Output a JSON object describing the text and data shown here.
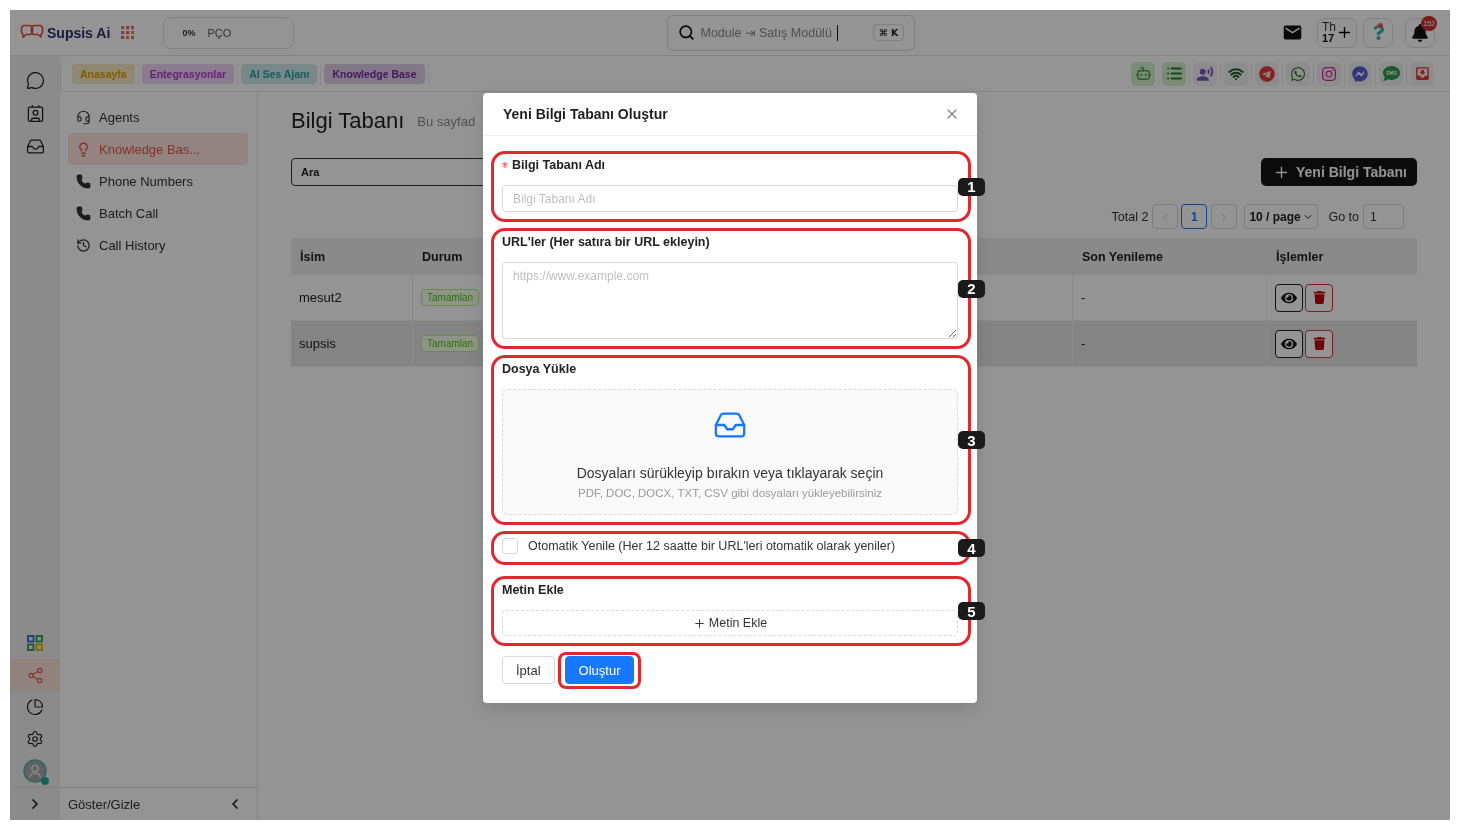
{
  "header": {
    "brand": "Supsis Ai",
    "usage": {
      "percent": "0%",
      "label": "PÇO"
    },
    "search": {
      "value": "Module ⇥ Satış Modülü",
      "shortcut": "⌘ K"
    },
    "calendar": {
      "weekday": "Th",
      "day": "17"
    },
    "help": {
      "alert": true
    },
    "notifications": {
      "count": "152"
    }
  },
  "tabs": [
    {
      "label": "Anasayfa",
      "color": "#908873"
    },
    {
      "label": "Entegrasyonlar",
      "color": "#8a7b8e"
    },
    {
      "label": "AI Ses Ajanı",
      "color": "#788888"
    },
    {
      "label": "Knowledge Base",
      "color": "#837888"
    }
  ],
  "channels": [
    {
      "active": true
    },
    {
      "active": true
    },
    {
      "active": false
    },
    {
      "active": false
    },
    {
      "active": false
    },
    {
      "active": false
    },
    {
      "active": false
    },
    {
      "active": false
    },
    {
      "active": false
    },
    {
      "active": false
    }
  ],
  "rail": {
    "top": [
      {
        "selected": false
      },
      {
        "selected": false
      },
      {
        "selected": false
      }
    ],
    "bottom": [
      {
        "selected": false
      },
      {
        "selected": true
      },
      {
        "selected": false
      },
      {
        "selected": false
      }
    ],
    "user": {
      "online": true
    }
  },
  "sidebar": {
    "items": [
      {
        "label": "Agents",
        "selected": false
      },
      {
        "label": "Knowledge Bas...",
        "selected": true
      },
      {
        "label": "Phone Numbers",
        "selected": false
      },
      {
        "label": "Batch Call",
        "selected": false
      },
      {
        "label": "Call History",
        "selected": false
      }
    ],
    "footer": "Göster/Gizle"
  },
  "page": {
    "title": "Bilgi Tabanı",
    "subtitle": "Bu sayfad",
    "search": {
      "placeholder": "Ara"
    },
    "new_button": "Yeni Bilgi Tabanı",
    "pagination": {
      "total": "Total 2",
      "prev_disabled": true,
      "next_disabled": true,
      "pages": [
        {
          "label": "1",
          "selected": true
        }
      ],
      "page_size": "10 / page",
      "goto_label": "Go to",
      "goto_value": "1"
    }
  },
  "table": {
    "columns": [
      "İsim",
      "Durum",
      "Son Yenileme",
      "İşlemler"
    ],
    "rows": [
      {
        "name": "mesut2",
        "status": "Tamamlan",
        "last_refresh": "-",
        "hovered": false
      },
      {
        "name": "supsis",
        "status": "Tamamlan",
        "last_refresh": "-",
        "hovered": true
      }
    ]
  },
  "modal": {
    "title": "Yeni Bilgi Tabanı Oluştur",
    "fields": [
      {
        "kind": "input",
        "label": "Bilgi Tabanı Adı",
        "required": true,
        "placeholder": "Bilgi Tabanı Adı",
        "callout": "1"
      },
      {
        "kind": "textarea",
        "label": "URL'ler (Her satıra bir URL ekleyin)",
        "required": false,
        "placeholder": "https://www.example.com",
        "callout": "2"
      },
      {
        "kind": "upload",
        "label": "Dosya Yükle",
        "required": false,
        "text": "Dosyaları sürükleyip bırakın veya tıklayarak seçin",
        "hint": "PDF, DOC, DOCX, TXT, CSV gibi dosyaları yükleyebilirsiniz",
        "callout": "3"
      },
      {
        "kind": "checkbox",
        "label": "Otomatik Yenile (Her 12 saatte bir URL'leri otomatik olarak yeniler)",
        "checked": false,
        "callout": "4"
      },
      {
        "kind": "add",
        "label": "Metin Ekle",
        "required": false,
        "button": "Metin Ekle",
        "callout": "5"
      }
    ],
    "buttons": [
      {
        "label": "İptal",
        "kind": "default",
        "circled": false
      },
      {
        "label": "Oluştur",
        "kind": "primary",
        "circled": true
      }
    ]
  }
}
